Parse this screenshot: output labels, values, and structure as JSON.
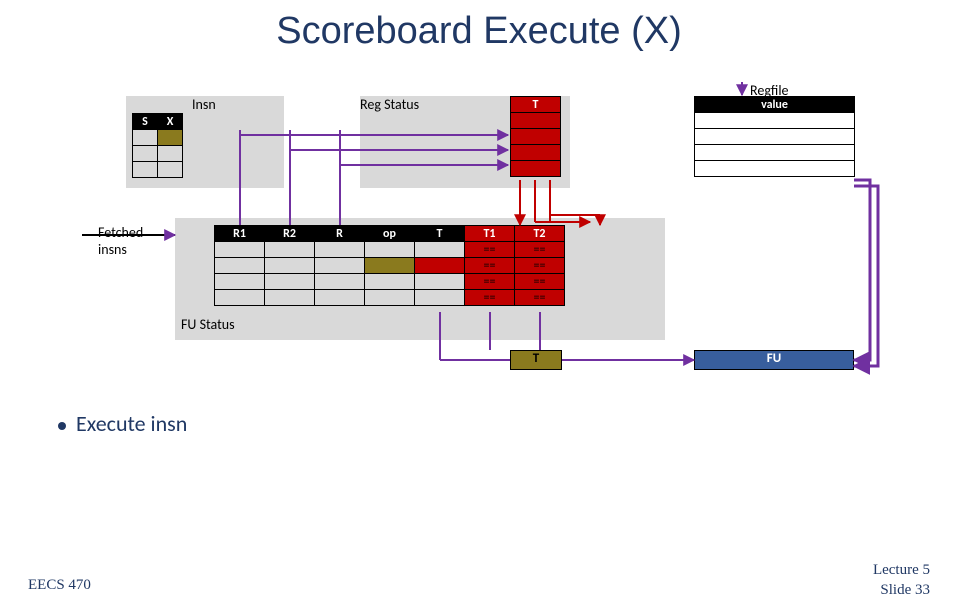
{
  "title": "Scoreboard Execute (X)",
  "labels": {
    "insn": "Insn",
    "regstatus": "Reg Status",
    "regfile": "Regfile",
    "fetched": "Fetched\ninsns",
    "fustatus": "FU Status"
  },
  "insn_table": {
    "headers": [
      "S",
      "X"
    ]
  },
  "regstatus_table": {
    "header": "T"
  },
  "regfile_table": {
    "header": "value"
  },
  "fu_table": {
    "headers": [
      "R1",
      "R2",
      "R",
      "op",
      "T",
      "T1",
      "T2"
    ],
    "eq": "=="
  },
  "t_box": "T",
  "fu_box": "FU",
  "bullet": "Execute insn",
  "footer_left": "EECS 470",
  "footer_right_1": "Lecture 5",
  "footer_right_2": "Slide 33"
}
